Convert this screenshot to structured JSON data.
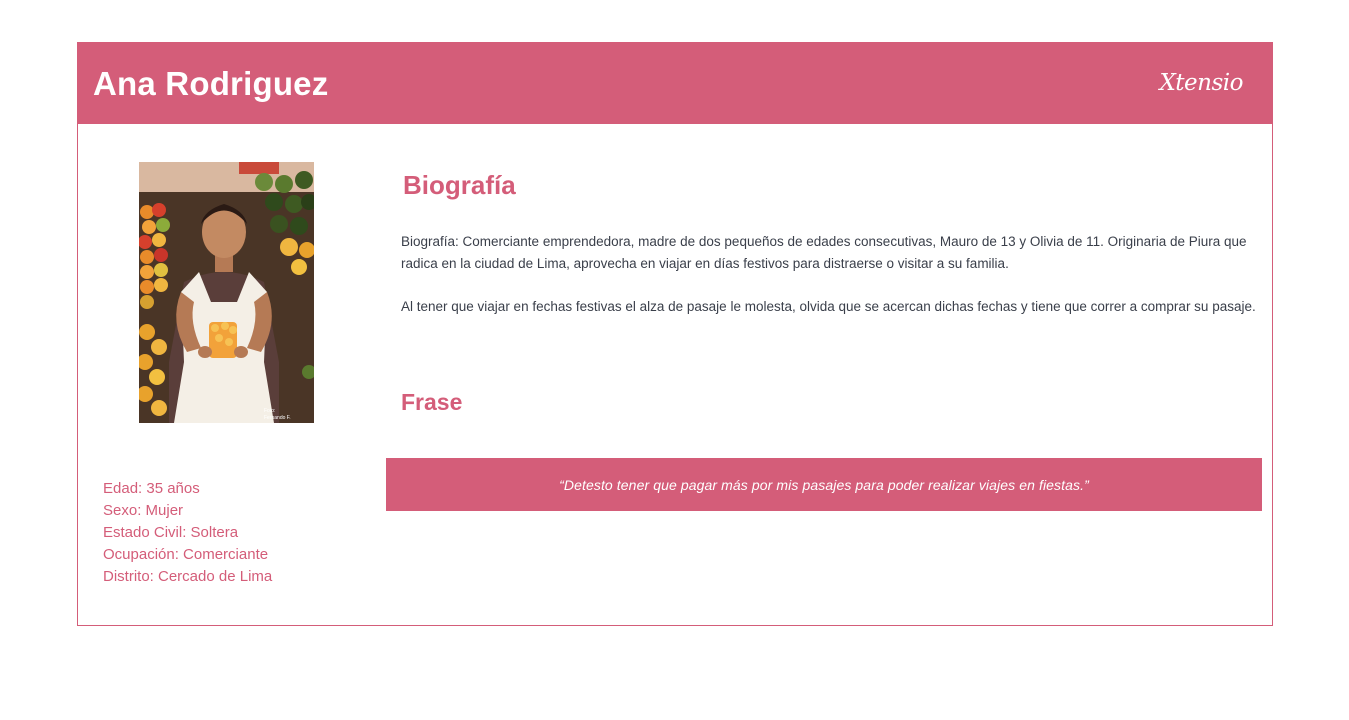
{
  "persona": {
    "name": "Ana Rodriguez",
    "brand": "Xtensio"
  },
  "photo": {
    "credit_line1": "Foto:",
    "credit_line2": "Fernando F."
  },
  "demographics": [
    "Edad: 35 años",
    "Sexo: Mujer",
    "Estado Civil: Soltera",
    "Ocupación: Comerciante",
    "Distrito: Cercado de Lima"
  ],
  "biography": {
    "title": "Biografía",
    "paragraphs": [
      "Biografía: Comerciante emprendedora, madre de dos pequeños de edades consecutivas, Mauro de 13 y Olivia de 11. Originaria de Piura que radica en la ciudad de Lima, aprovecha en viajar en días festivos para distraerse o visitar a su familia.",
      "Al tener que viajar en fechas festivas el alza de pasaje le molesta, olvida que se acercan dichas fechas y tiene que correr a comprar su pasaje."
    ]
  },
  "quote": {
    "title": "Frase",
    "text": "“Detesto tener que pagar más por mis pasajes para poder realizar viajes en fiestas.”"
  },
  "colors": {
    "accent": "#d45d79",
    "body_text": "#3a3f4a"
  }
}
